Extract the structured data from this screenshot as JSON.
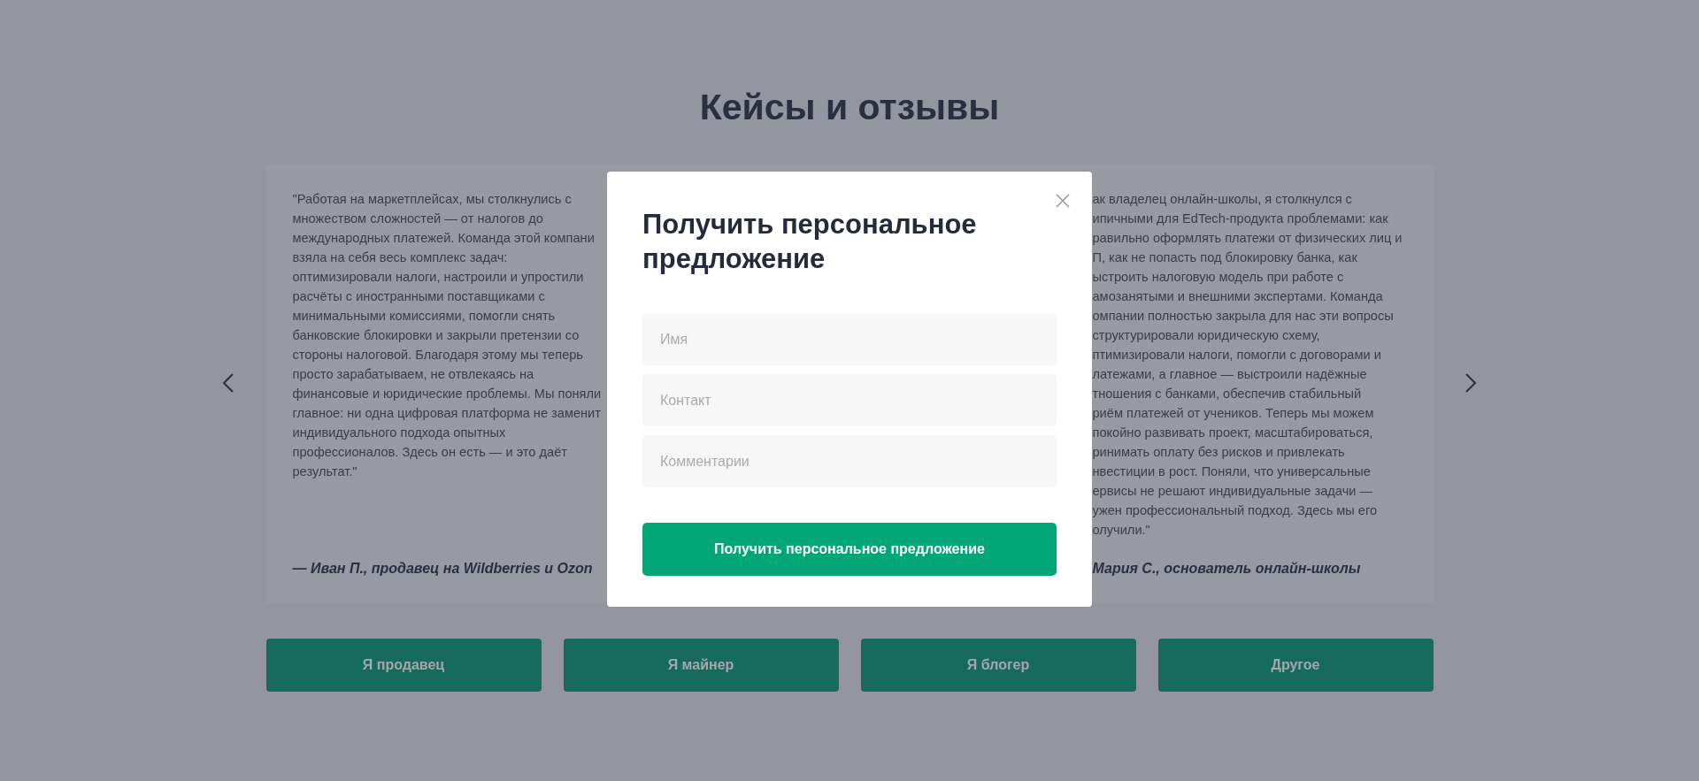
{
  "section_title": "Кейсы и отзывы",
  "testimonials": [
    {
      "lines": [
        "\"Работая на маркетплейсах, мы столкнулись с",
        "множеством сложностей — от налогов до",
        "международных платежей. Команда этой компани",
        "взяла на себя весь комплекс задач:",
        "оптимизировали налоги, настроили и упростили",
        "расчёты с иностранными поставщиками с",
        "минимальными комиссиями, помогли снять",
        "банковские блокировки и закрыли претензии со",
        "стороны налоговой. Благодаря этому мы теперь",
        "просто зарабатываем, не отвлекаясь на",
        "финансовые и юридические проблемы. Мы поняли",
        "главное: ни одна цифровая платформа не заменит",
        "индивидуального подхода опытных",
        "профессионалов. Здесь он есть — и это даёт",
        "результат.\""
      ],
      "author": "— Иван П., продавец на Wildberries и Ozon"
    },
    {
      "lines": [
        "ак владелец онлайн-школы, я столкнулся с",
        "ипичными для EdTech-продукта проблемами: как",
        "равильно оформлять платежи от физических лиц и",
        "П, как не попасть под блокировку банка, как",
        "ыстроить налоговую модель при работе с",
        "амозанятыми и внешними экспертами. Команда",
        "омпании полностью закрыла для нас эти вопросы",
        "структурировали юридическую схему,",
        "птимизировали налоги, помогли с договорами и",
        "латежами, а главное — выстроили надёжные",
        "тношения с банками, обеспечив стабильный",
        "риём платежей от учеников. Теперь мы можем",
        "покойно развивать проект, масштабироваться,",
        "ринимать оплату без рисков и привлекать",
        "нвестиции в рост. Поняли, что универсальные",
        "ервисы не решают индивидуальные задачи —",
        "ужен профессиональный подход. Здесь мы его",
        "олучили.\""
      ],
      "author": "Мария С., основатель онлайн-школы"
    }
  ],
  "category_buttons": [
    "Я продавец",
    "Я майнер",
    "Я блогер",
    "Другое"
  ],
  "modal": {
    "title": "Получить персональное предложение",
    "fields": [
      {
        "placeholder": "Имя"
      },
      {
        "placeholder": "Контакт"
      },
      {
        "placeholder": "Комментарии"
      }
    ],
    "submit": "Получить персональное предложение"
  }
}
